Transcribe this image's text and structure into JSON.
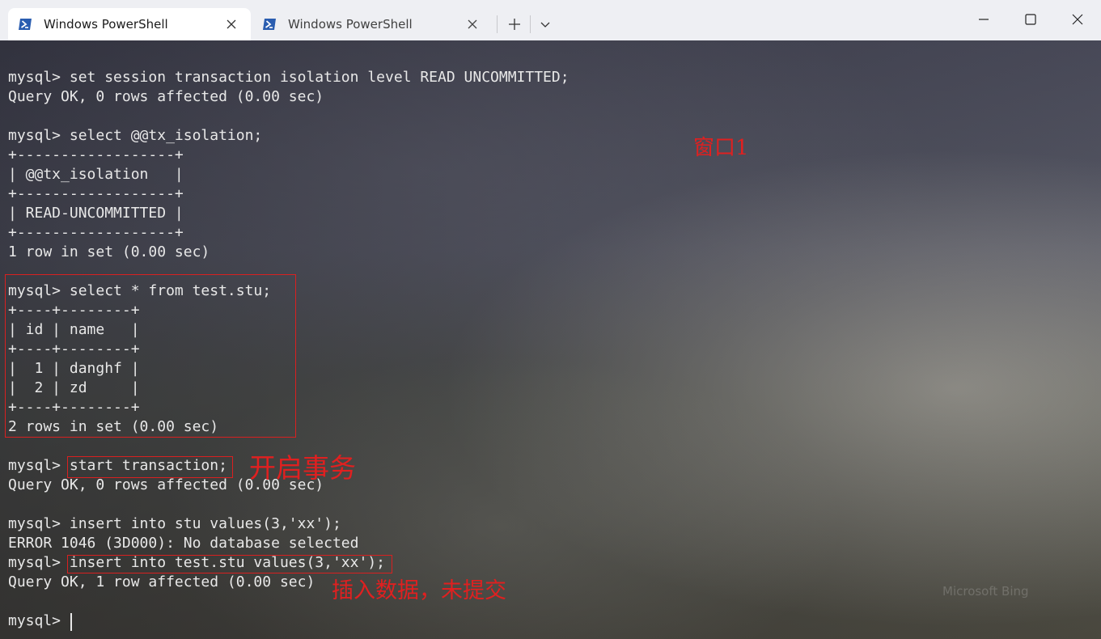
{
  "tabs": [
    {
      "title": "Windows PowerShell",
      "active": true,
      "icon": "powershell-icon"
    },
    {
      "title": "Windows PowerShell",
      "active": false,
      "icon": "powershell-icon"
    }
  ],
  "terminal": {
    "lines": [
      "mysql> set session transaction isolation level READ UNCOMMITTED;",
      "Query OK, 0 rows affected (0.00 sec)",
      "",
      "mysql> select @@tx_isolation;",
      "+------------------+",
      "| @@tx_isolation   |",
      "+------------------+",
      "| READ-UNCOMMITTED |",
      "+------------------+",
      "1 row in set (0.00 sec)",
      "",
      "mysql> select * from test.stu;",
      "+----+--------+",
      "| id | name   |",
      "+----+--------+",
      "|  1 | danghf |",
      "|  2 | zd     |",
      "+----+--------+",
      "2 rows in set (0.00 sec)",
      "",
      "mysql> start transaction;",
      "Query OK, 0 rows affected (0.00 sec)",
      "",
      "mysql> insert into stu values(3,'xx');",
      "ERROR 1046 (3D000): No database selected",
      "mysql> insert into test.stu values(3,'xx');",
      "Query OK, 1 row affected (0.00 sec)",
      "",
      "mysql> "
    ]
  },
  "annotations": {
    "window_label": "窗口1",
    "start_transaction": "开启事务",
    "insert_uncommitted": "插入数据，未提交"
  },
  "watermark": "Microsoft Bing",
  "colors": {
    "annotation": "#e02020",
    "terminal_text": "#e8e8e8",
    "titlebar": "#eeeff3"
  }
}
